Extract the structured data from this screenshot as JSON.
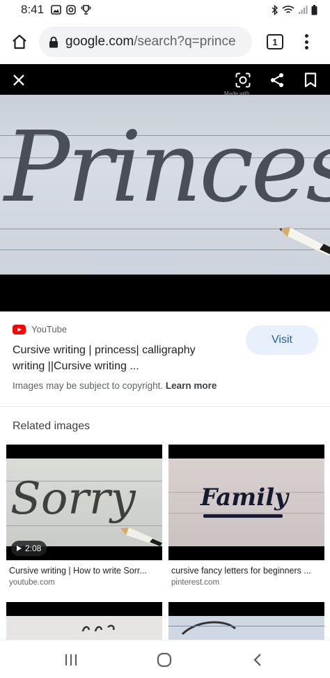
{
  "status_bar": {
    "time": "8:41"
  },
  "browser": {
    "url_host": "google.com",
    "url_path": "/search?q=prince",
    "tab_count": "1"
  },
  "viewer": {
    "hero_text": "Princess",
    "watermark": "Made with"
  },
  "result": {
    "source": "YouTube",
    "title": "Cursive writing | princess| calligraphy writing ||Cursive writing ...",
    "visit_label": "Visit",
    "copyright": "Images may be subject to copyright.",
    "learn_more": "Learn more"
  },
  "related": {
    "title": "Related images",
    "items": [
      {
        "thumb_text": "Sorry",
        "duration": "2:08",
        "caption": "Cursive writing | How to write Sorr...",
        "domain": "youtube.com"
      },
      {
        "thumb_text": "Family",
        "caption": "cursive fancy letters for beginners ...",
        "domain": "pinterest.com"
      }
    ]
  },
  "colors": {
    "accent": "#1a5fb4",
    "visit_bg": "#e8f0fe",
    "youtube_red": "#ff0000"
  }
}
